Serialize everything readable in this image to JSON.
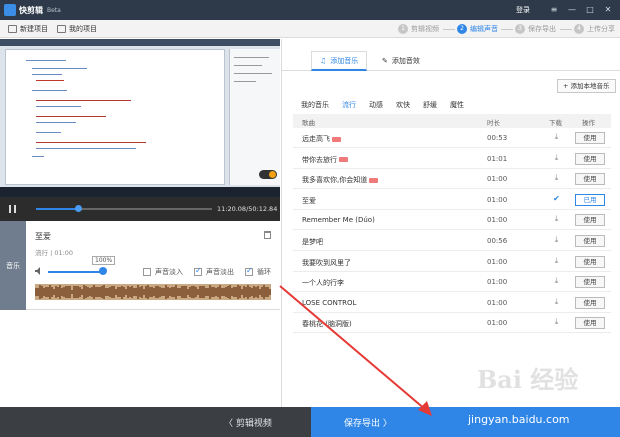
{
  "titlebar": {
    "app_name": "快剪辑",
    "badge": "Beta",
    "login": "登录",
    "controls": [
      "≡",
      "—",
      "□",
      "✕"
    ]
  },
  "toolbar": {
    "new_project": "新建项目",
    "my_projects": "我的项目",
    "steps": [
      {
        "num": "1",
        "label": "剪辑视频",
        "active": false
      },
      {
        "num": "2",
        "label": "编辑声音",
        "active": true
      },
      {
        "num": "3",
        "label": "保存导出",
        "active": false
      },
      {
        "num": "4",
        "label": "上传分享",
        "active": false
      }
    ]
  },
  "player": {
    "time": "11:20.08/50:12.84",
    "progress": 0.24
  },
  "music_panel": {
    "side_tab": "音乐",
    "title": "至爱",
    "meta": "流行 | 01:00",
    "volume_percent": "100%",
    "volume": 1.0,
    "fade_in_label": "声音淡入",
    "fade_in": false,
    "fade_out_label": "声音淡出",
    "fade_out": true,
    "loop_label": "循环",
    "loop": true
  },
  "right": {
    "tab_music": "添加音乐",
    "tab_sfx": "添加音效",
    "add_local": "添加本地音乐",
    "categories": [
      "我的音乐",
      "流行",
      "动感",
      "欢快",
      "舒缓",
      "魔性"
    ],
    "active_category": 1,
    "columns": {
      "song": "歌曲",
      "duration": "时长",
      "download": "下载",
      "action": "操作"
    },
    "songs": [
      {
        "name": "远走高飞",
        "tag": true,
        "duration": "00:53",
        "downloaded": false,
        "action": "使用",
        "used": false
      },
      {
        "name": "带你去旅行",
        "tag": true,
        "duration": "01:01",
        "downloaded": false,
        "action": "使用",
        "used": false
      },
      {
        "name": "我多喜欢你,你会知道",
        "tag": true,
        "duration": "01:00",
        "downloaded": false,
        "action": "使用",
        "used": false
      },
      {
        "name": "至爱",
        "tag": false,
        "duration": "01:00",
        "downloaded": true,
        "action": "已用",
        "used": true
      },
      {
        "name": "Remember Me (Dúo)",
        "tag": false,
        "duration": "01:00",
        "downloaded": false,
        "action": "使用",
        "used": false
      },
      {
        "name": "是梦吧",
        "tag": false,
        "duration": "00:56",
        "downloaded": false,
        "action": "使用",
        "used": false
      },
      {
        "name": "我要吹到风里了",
        "tag": false,
        "duration": "01:00",
        "downloaded": false,
        "action": "使用",
        "used": false
      },
      {
        "name": "一个人的行李",
        "tag": false,
        "duration": "01:00",
        "downloaded": false,
        "action": "使用",
        "used": false
      },
      {
        "name": "LOSE CONTROL",
        "tag": false,
        "duration": "01:00",
        "downloaded": false,
        "action": "使用",
        "used": false
      },
      {
        "name": "春桃花 (脑洞版)",
        "tag": false,
        "duration": "01:00",
        "downloaded": false,
        "action": "使用",
        "used": false
      }
    ]
  },
  "bottom": {
    "back": "〈 剪辑视频",
    "export": "保存导出 〉"
  },
  "watermark": {
    "logo": "Bai 经验",
    "url": "jingyan.baidu.com"
  },
  "colors": {
    "accent": "#2f86e6",
    "titlebar": "#2e3a4a",
    "bottom_bar": "#3b3f44",
    "arrow": "#e53935"
  }
}
